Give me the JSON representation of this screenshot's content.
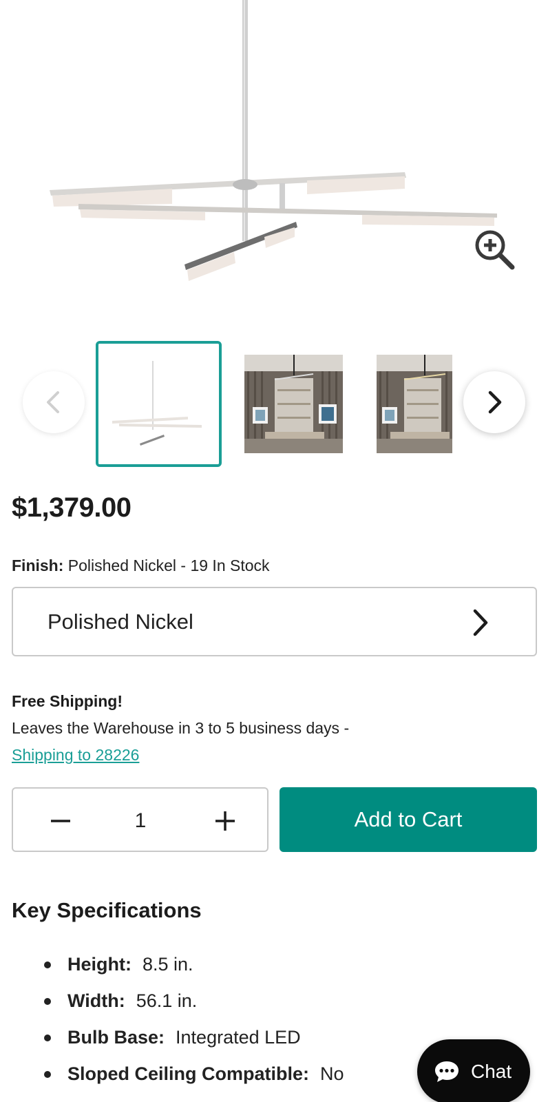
{
  "product": {
    "price": "$1,379.00",
    "finish_label": "Finish:",
    "finish_value": "Polished Nickel - 19 In Stock",
    "selected_finish": "Polished Nickel"
  },
  "shipping": {
    "title": "Free Shipping!",
    "text": "Leaves the Warehouse in 3 to 5 business days -",
    "link": "Shipping to 28226"
  },
  "cart": {
    "quantity": "1",
    "add_to_cart": "Add to Cart"
  },
  "specs": {
    "title": "Key Specifications",
    "items": [
      {
        "label": "Height:",
        "value": "8.5 in."
      },
      {
        "label": "Width:",
        "value": "56.1 in."
      },
      {
        "label": "Bulb Base:",
        "value": "Integrated LED"
      },
      {
        "label": "Sloped Ceiling Compatible:",
        "value": "No"
      }
    ]
  },
  "chat": {
    "label": "Chat"
  },
  "icons": {
    "zoom": "zoom-in-icon",
    "prev": "chevron-left-icon",
    "next": "chevron-right-icon",
    "select": "chevron-right-icon",
    "minus": "minus-icon",
    "plus": "plus-icon",
    "chat": "chat-bubble-icon"
  },
  "colors": {
    "accent": "#008c80",
    "link": "#1a9e96",
    "chat_bg": "#0b0b0b"
  }
}
